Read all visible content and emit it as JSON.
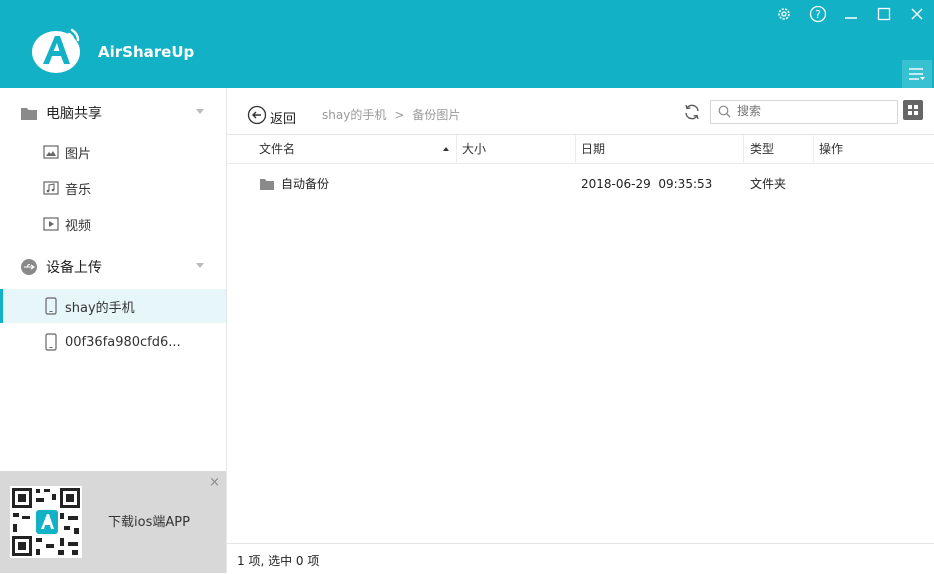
{
  "app": {
    "title": "AirShareUp"
  },
  "window_controls": {
    "settings": "settings-icon",
    "help": "help-icon",
    "minimize": "minimize-icon",
    "maximize": "maximize-icon",
    "close": "close-icon"
  },
  "sidebar": {
    "sections": [
      {
        "label": "电脑共享",
        "items": [
          {
            "label": "图片"
          },
          {
            "label": "音乐"
          },
          {
            "label": "视频"
          }
        ]
      },
      {
        "label": "设备上传",
        "items": [
          {
            "label": "shay的手机"
          },
          {
            "label": "00f36fa980cfd6..."
          }
        ]
      }
    ],
    "promo": {
      "text": "下载ios端APP",
      "close": "×"
    }
  },
  "toolbar": {
    "back_label": "返回",
    "breadcrumb": [
      "shay的手机",
      "备份图片"
    ],
    "breadcrumb_sep": ">",
    "search_placeholder": "搜索"
  },
  "table": {
    "columns": [
      "文件名",
      "大小",
      "日期",
      "类型",
      "操作"
    ],
    "rows": [
      {
        "name": "自动备份",
        "size": "",
        "date": "2018-06-29  09:35:53",
        "type": "文件夹",
        "action": ""
      }
    ]
  },
  "status": {
    "text": "1 项, 选中 0 项"
  },
  "colors": {
    "accent": "#13b1c5",
    "active_bg": "#e6f6f9",
    "promo_bg": "#d8d8d8"
  }
}
